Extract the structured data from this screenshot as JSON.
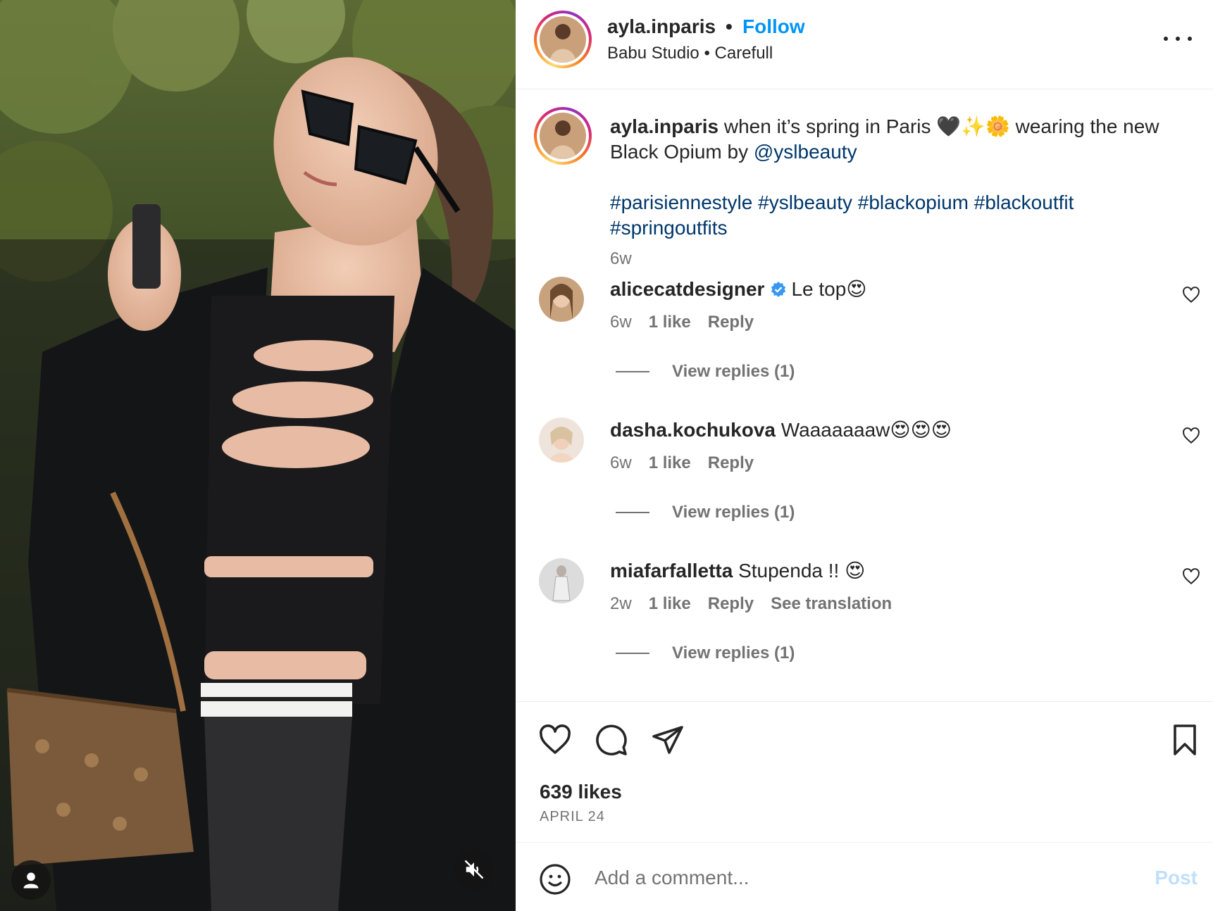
{
  "post": {
    "username": "ayla.inparis",
    "separator": "•",
    "follow_label": "Follow",
    "location": "Babu Studio • Carefull"
  },
  "caption": {
    "username": "ayla.inparis",
    "text_before_mention": "when it’s spring in Paris 🖤✨🌼 wearing the new Black Opium by",
    "mention": "@yslbeauty",
    "hashtags": "#parisiennestyle #yslbeauty #blackopium #blackoutfit #springoutfits",
    "time": "6w"
  },
  "comments": [
    {
      "username": "alicecatdesigner",
      "verified": true,
      "text": "Le top😍",
      "time": "6w",
      "likes": "1 like",
      "reply_label": "Reply",
      "extra_label": "",
      "view_replies": "View replies (1)"
    },
    {
      "username": "dasha.kochukova",
      "verified": false,
      "text": "Waaaaaaaw😍😍😍",
      "time": "6w",
      "likes": "1 like",
      "reply_label": "Reply",
      "extra_label": "",
      "view_replies": "View replies (1)"
    },
    {
      "username": "miafarfalletta",
      "verified": false,
      "text": "Stupenda !! 😍",
      "time": "2w",
      "likes": "1 like",
      "reply_label": "Reply",
      "extra_label": "See translation",
      "view_replies": "View replies (1)"
    }
  ],
  "stats": {
    "likes": "639 likes",
    "date": "APRIL 24"
  },
  "composer": {
    "placeholder": "Add a comment...",
    "post_label": "Post"
  },
  "colors": {
    "link_blue": "#0095f6",
    "mention_navy": "#00376b",
    "muted_gray": "#737373",
    "text": "#262626"
  },
  "icons": {
    "user": "user-icon",
    "mute": "speaker-muted-icon",
    "more": "more-horizontal-icon",
    "like": "heart-icon",
    "comment": "comment-bubble-icon",
    "share": "paper-plane-icon",
    "save": "bookmark-icon",
    "emoji": "smiley-icon",
    "verified": "verified-badge-icon"
  }
}
